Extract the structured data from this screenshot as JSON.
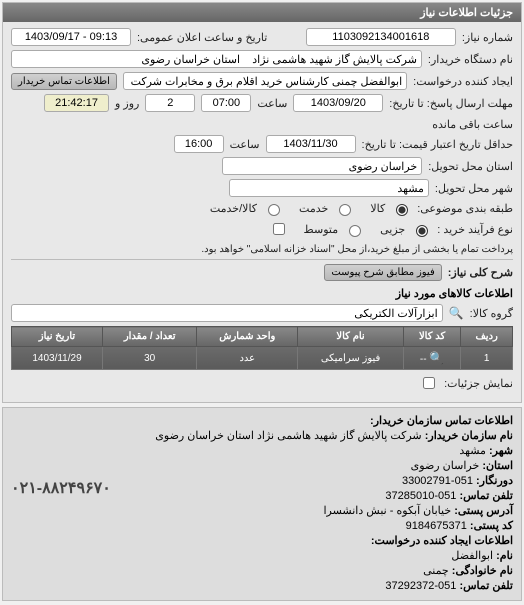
{
  "panel_title": "جزئیات اطلاعات نیاز",
  "header": {
    "need_number_label": "شماره نیاز:",
    "need_number": "1103092134001618",
    "announce_label": "تاریخ و ساعت اعلان عمومی:",
    "announce_value": "09:13 - 1403/09/17"
  },
  "buyer": {
    "org_label": "نام دستگاه خریدار:",
    "org_value": "شرکت پالایش گاز شهید هاشمی نژاد    استان خراسان رضوی",
    "creator_label": "ایجاد کننده درخواست:",
    "creator_value": "ابوالفضل چمنی کارشناس خرید اقلام برق و مخابرات شرکت پالایش گاز شهید ه",
    "contact_btn": "اطلاعات تماس خریدار"
  },
  "deadlines": {
    "response_until_label": "مهلت ارسال پاسخ: تا تاریخ:",
    "response_date": "1403/09/20",
    "response_time_label": "ساعت",
    "response_time": "07:00",
    "days_label": "روز و",
    "days_value": "2",
    "remaining_time": "21:42:17",
    "remaining_label": "ساعت باقی مانده",
    "purchase_label": "حداقل تاریخ اعتبار قیمت: تا تاریخ:",
    "purchase_date": "1403/11/30",
    "purchase_time_label": "ساعت",
    "purchase_time": "16:00"
  },
  "location": {
    "province_label": "استان محل تحویل:",
    "province_value": "خراسان رضوی",
    "city_label": "شهر محل تحویل:",
    "city_value": "مشهد"
  },
  "classification": {
    "category_label": "طبقه بندی موضوعی:",
    "goods": "کالا",
    "service": "خدمت",
    "goods_service": "کالا/خدمت",
    "selected_category": "goods"
  },
  "approval": {
    "process_label": "نوع فرآیند خرید :",
    "partial": "جزیی",
    "medium": "متوسط",
    "note": "پرداخت تمام یا بخشی از مبلغ خرید،از محل \"اسناد خزانه اسلامی\" خواهد بود.",
    "selected_process": "partial"
  },
  "need_desc": {
    "label": "شرح کلی نیاز:",
    "attach_btn": "فیوز مطابق شرح پیوست"
  },
  "goods_section": {
    "title": "اطلاعات کالاهای مورد نیاز",
    "group_label": "گروه کالا:",
    "group_value": "ابزارآلات الکتریکی"
  },
  "table": {
    "headers": {
      "row": "ردیف",
      "code": "کد کالا",
      "name": "نام کالا",
      "unit": "واحد شمارش",
      "qty": "تعداد / مقدار",
      "date": "تاریخ نیاز"
    },
    "rows": [
      {
        "row": "1",
        "code": "--",
        "name": "فیوز سرامیکی",
        "unit": "عدد",
        "qty": "30",
        "date": "1403/11/29"
      }
    ]
  },
  "more_details": {
    "checkbox_label": "نمایش جزئیات:"
  },
  "contact_info": {
    "section1": "اطلاعات تماس سازمان خریدار:",
    "org_name_label": "نام سازمان خریدار:",
    "org_name": "شرکت پالایش گاز شهید هاشمی نژاد استان خراسان رضوی",
    "city_label": "شهر:",
    "city": "مشهد",
    "province_label": "استان:",
    "province": "خراسان رضوی",
    "prefix_label": "دورنگار:",
    "prefix": "051-33002791",
    "phone_label": "تلفن تماس:",
    "phone": "051-37285010",
    "postal_label": "آدرس پستی:",
    "postal": "خیابان آبکوه - نبش دانشسرا",
    "postal_code_label": "کد پستی:",
    "postal_code": "9184675371",
    "section2": "اطلاعات ایجاد کننده درخواست:",
    "name_label": "نام:",
    "name": "ابوالفضل",
    "family_label": "نام خانوادگی:",
    "family": "چمنی",
    "creator_phone_label": "تلفن تماس:",
    "creator_phone": "051-37292372",
    "big_phone": "۰۲۱-۸۸۲۴۹۶۷۰"
  }
}
